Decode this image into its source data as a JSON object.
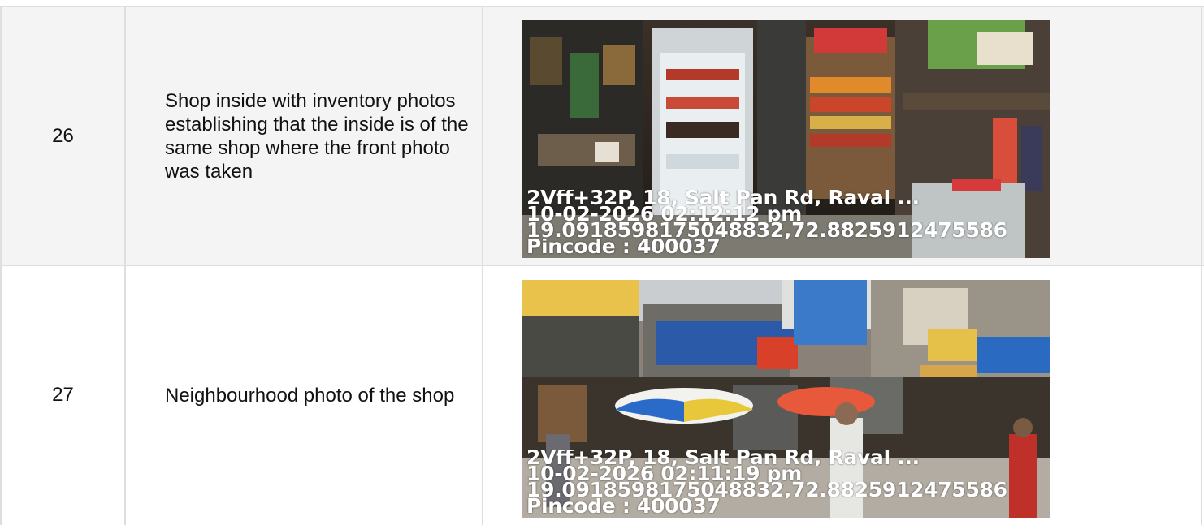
{
  "rows": [
    {
      "number": "26",
      "description": "Shop inside with inventory photos establishing that the inside is of the same shop where the front photo was taken",
      "photo": {
        "address": "2Vff+32P, 18, Salt Pan Rd, Raval ...",
        "datetime": "10-02-2026 02:12:12 pm",
        "coords": "19.0918598175048832,72.8825912475586",
        "pincode": "Pincode : 400037"
      }
    },
    {
      "number": "27",
      "description": "Neighbourhood photo of the shop",
      "photo": {
        "address": "2Vff+32P, 18, Salt Pan Rd, Raval ...",
        "datetime": "10-02-2026 02:11:19 pm",
        "coords": "19.0918598175048832,72.8825912475586",
        "pincode": "Pincode : 400037"
      }
    }
  ]
}
